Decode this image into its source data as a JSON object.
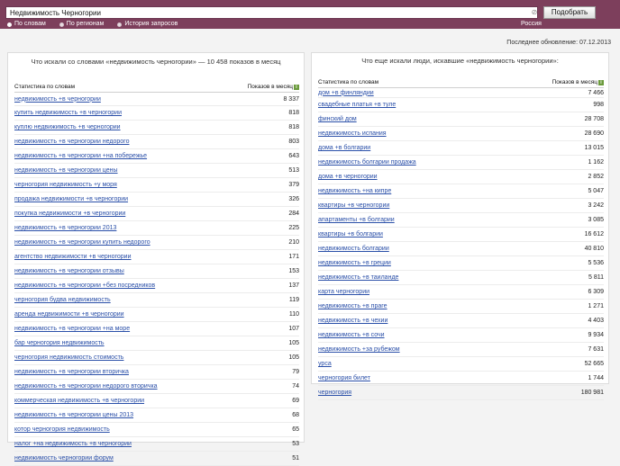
{
  "search": {
    "query": "Недвижимость Черногории",
    "button_label": "Подобрать",
    "clear_glyph": "⊘"
  },
  "modes": [
    {
      "label": "По словам",
      "selected": true
    },
    {
      "label": "По регионам",
      "selected": false
    },
    {
      "label": "История запросов",
      "selected": false
    }
  ],
  "region": "Россия",
  "updated": "Последнее обновление: 07.12.2013",
  "left": {
    "title": "Что искали со словами «недвижимость черногории» — 10 458 показов в месяц",
    "col_keywords": "Статистика по словам",
    "col_count": "Показов в месяц",
    "rows": [
      {
        "phrase": "недвижимость +в черногории",
        "count": "8 337"
      },
      {
        "phrase": "купить недвижимость +в черногории",
        "count": "818"
      },
      {
        "phrase": "куплю недвижимость +в черногории",
        "count": "818"
      },
      {
        "phrase": "недвижимость +в черногории недорого",
        "count": "803"
      },
      {
        "phrase": "недвижимость +в черногории +на побережье",
        "count": "643"
      },
      {
        "phrase": "недвижимость +в черногории цены",
        "count": "513"
      },
      {
        "phrase": "черногория недвижимость +у моря",
        "count": "379"
      },
      {
        "phrase": "продажа недвижимости +в черногории",
        "count": "326"
      },
      {
        "phrase": "покупка недвижимости +в черногории",
        "count": "284"
      },
      {
        "phrase": "недвижимость +в черногории 2013",
        "count": "225"
      },
      {
        "phrase": "недвижимость +в черногории купить недорого",
        "count": "210"
      },
      {
        "phrase": "агентство недвижимости +в черногории",
        "count": "171"
      },
      {
        "phrase": "недвижимость +в черногории отзывы",
        "count": "153"
      },
      {
        "phrase": "недвижимость +в черногории +без посредников",
        "count": "137"
      },
      {
        "phrase": "черногория будва недвижимость",
        "count": "119"
      },
      {
        "phrase": "аренда недвижимости +в черногории",
        "count": "110"
      },
      {
        "phrase": "недвижимость +в черногории +на море",
        "count": "107"
      },
      {
        "phrase": "бар черногория недвижимость",
        "count": "105"
      },
      {
        "phrase": "черногория недвижимость стоимость",
        "count": "105"
      },
      {
        "phrase": "недвижимость +в черногории вторичка",
        "count": "79"
      },
      {
        "phrase": "недвижимость +в черногории недорого вторичка",
        "count": "74"
      },
      {
        "phrase": "коммерческая недвижимость +в черногории",
        "count": "69"
      },
      {
        "phrase": "недвижимость +в черногории цены 2013",
        "count": "68"
      },
      {
        "phrase": "котор черногория недвижимость",
        "count": "65"
      },
      {
        "phrase": "налог +на недвижимость +в черногории",
        "count": "53"
      },
      {
        "phrase": "недвижимость черногории форум",
        "count": "51"
      }
    ]
  },
  "right": {
    "title": "Что еще искали люди, искавшие «недвижимость черногории»:",
    "col_keywords": "Статистика по словам",
    "col_count": "Показов в месяц",
    "rows": [
      {
        "phrase": "дом +в финляндии",
        "count": "7 466"
      },
      {
        "phrase": "свадебные платья +в туле",
        "count": "998"
      },
      {
        "phrase": "финский дом",
        "count": "28 708"
      },
      {
        "phrase": "недвижимость испания",
        "count": "28 690"
      },
      {
        "phrase": "дома +в болгарии",
        "count": "13 015"
      },
      {
        "phrase": "недвижимость болгарии продажа",
        "count": "1 162"
      },
      {
        "phrase": "дома +в черногории",
        "count": "2 852"
      },
      {
        "phrase": "недвижимость +на кипре",
        "count": "5 047"
      },
      {
        "phrase": "квартиры +в черногории",
        "count": "3 242"
      },
      {
        "phrase": "апартаменты +в болгарии",
        "count": "3 085"
      },
      {
        "phrase": "квартиры +в болгарии",
        "count": "16 612"
      },
      {
        "phrase": "недвижимость болгарии",
        "count": "40 810"
      },
      {
        "phrase": "недвижимость +в греции",
        "count": "5 536"
      },
      {
        "phrase": "недвижимость +в таиланде",
        "count": "5 811"
      },
      {
        "phrase": "карта черногории",
        "count": "6 309"
      },
      {
        "phrase": "недвижимость +в праге",
        "count": "1 271"
      },
      {
        "phrase": "недвижимость +в чехии",
        "count": "4 403"
      },
      {
        "phrase": "недвижимость +в сочи",
        "count": "9 934"
      },
      {
        "phrase": "недвижимость +за рубежом",
        "count": "7 631"
      },
      {
        "phrase": "урса",
        "count": "52 665"
      },
      {
        "phrase": "черногория билет",
        "count": "1 744"
      },
      {
        "phrase": "черногория",
        "count": "180 981"
      }
    ]
  }
}
